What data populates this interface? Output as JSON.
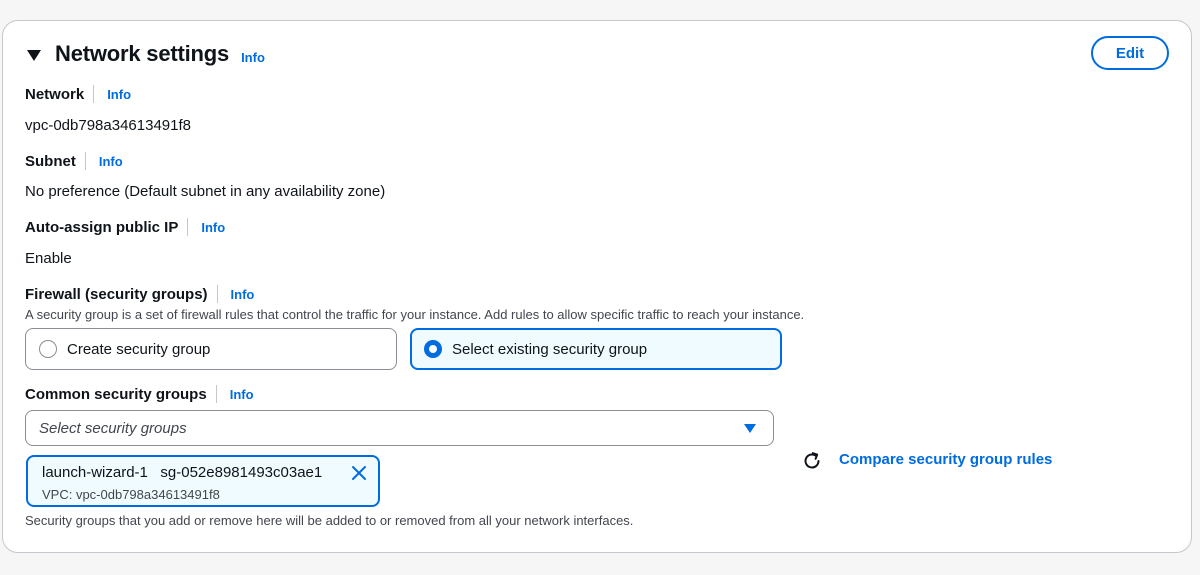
{
  "section": {
    "title": "Network settings",
    "info": "Info",
    "edit_label": "Edit"
  },
  "network": {
    "label": "Network",
    "info": "Info",
    "value": "vpc-0db798a34613491f8"
  },
  "subnet": {
    "label": "Subnet",
    "info": "Info",
    "value": "No preference (Default subnet in any availability zone)"
  },
  "public_ip": {
    "label": "Auto-assign public IP",
    "info": "Info",
    "value": "Enable"
  },
  "firewall": {
    "label": "Firewall (security groups)",
    "info": "Info",
    "description": "A security group is a set of firewall rules that control the traffic for your instance. Add rules to allow specific traffic to reach your instance.",
    "options": [
      {
        "label": "Create security group",
        "selected": false
      },
      {
        "label": "Select existing security group",
        "selected": true
      }
    ]
  },
  "common_groups": {
    "label": "Common security groups",
    "info": "Info",
    "placeholder": "Select security groups",
    "selected_token": {
      "name": "launch-wizard-1",
      "id": "sg-052e8981493c03ae1",
      "vpc": "VPC: vpc-0db798a34613491f8"
    },
    "compare_link": "Compare security group rules",
    "footer_note": "Security groups that you add or remove here will be added to or removed from all your network interfaces."
  },
  "colors": {
    "link": "#006ce0",
    "text": "#0f141a",
    "secondary_text": "#424650",
    "selected_bg": "#f0fbff"
  },
  "icons": {
    "caret": "caret-down-icon",
    "dropdown": "dropdown-arrow-icon",
    "remove": "close-icon",
    "refresh": "refresh-icon"
  }
}
